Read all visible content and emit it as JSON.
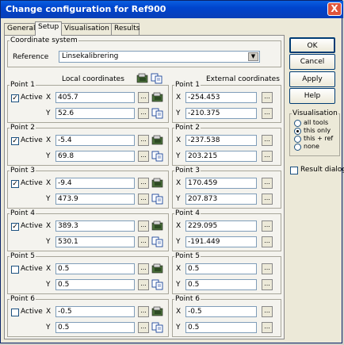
{
  "window": {
    "title": "Change configuration for Ref900",
    "close_glyph": "X"
  },
  "tabs": [
    "General",
    "Setup",
    "Visualisation",
    "Results"
  ],
  "coordinate_system": {
    "group_label": "Coordinate system",
    "reference_label": "Reference",
    "reference_value": "Linsekalibrering"
  },
  "headers": {
    "local": "Local coordinates",
    "external": "External coordinates"
  },
  "labels": {
    "active": "Active",
    "x": "X",
    "y": "Y",
    "dots": "..."
  },
  "points": [
    {
      "name": "Point 1",
      "active": true,
      "local_x": "405.7",
      "local_y": "52.6",
      "ext_x": "-254.453",
      "ext_y": "-210.375"
    },
    {
      "name": "Point 2",
      "active": true,
      "local_x": "-5.4",
      "local_y": "69.8",
      "ext_x": "-237.538",
      "ext_y": "203.215"
    },
    {
      "name": "Point 3",
      "active": true,
      "local_x": "-9.4",
      "local_y": "473.9",
      "ext_x": "170.459",
      "ext_y": "207.873"
    },
    {
      "name": "Point 4",
      "active": true,
      "local_x": "389.3",
      "local_y": "530.1",
      "ext_x": "229.095",
      "ext_y": "-191.449"
    },
    {
      "name": "Point 5",
      "active": false,
      "local_x": "0.5",
      "local_y": "0.5",
      "ext_x": "0.5",
      "ext_y": "0.5"
    },
    {
      "name": "Point 6",
      "active": false,
      "local_x": "-0.5",
      "local_y": "0.5",
      "ext_x": "-0.5",
      "ext_y": "0.5"
    }
  ],
  "buttons": {
    "ok": "OK",
    "cancel": "Cancel",
    "apply": "Apply",
    "help": "Help"
  },
  "visualisation": {
    "group_label": "Visualisation",
    "options": [
      "all tools",
      "this only",
      "this + ref",
      "none"
    ],
    "selected": "this only"
  },
  "result_dialog": {
    "label": "Result dialog",
    "checked": false
  }
}
